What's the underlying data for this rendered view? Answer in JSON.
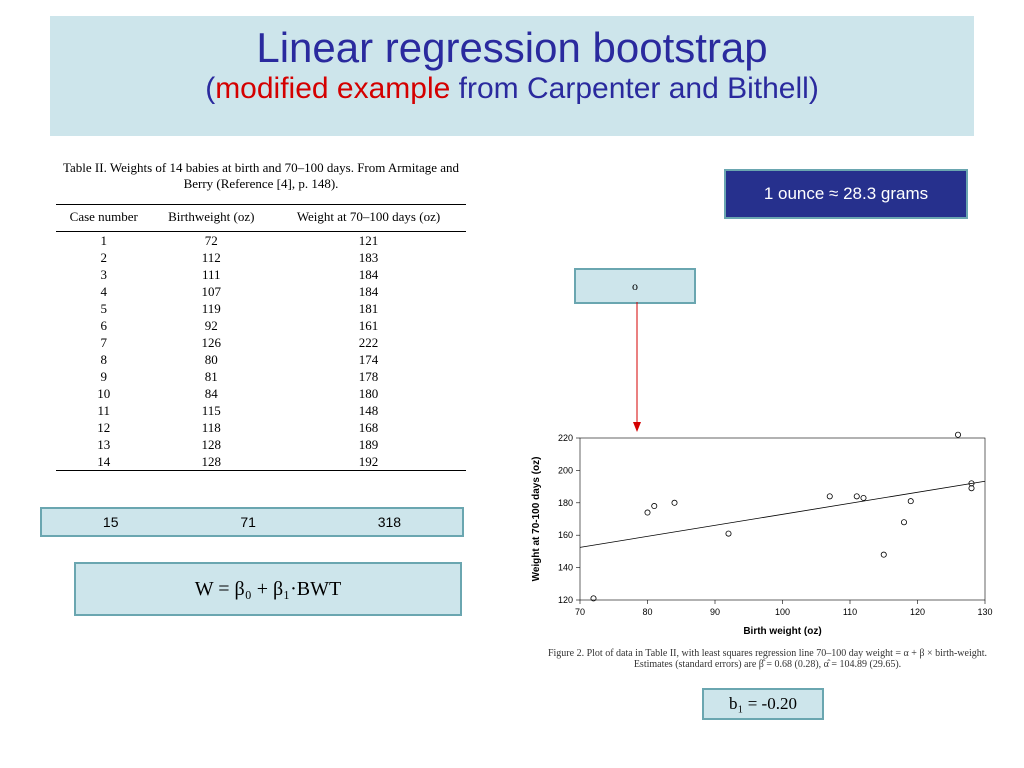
{
  "title": "Linear regression bootstrap",
  "subtitle_red": "modified example",
  "subtitle_rest": " from Carpenter and Bithell)",
  "subtitle_open": "(",
  "ounce": "1 ounce ≈ 28.3 grams",
  "outlier_mark": "o",
  "table_caption": "Table II.  Weights of 14 babies at birth and 70–100 days. From Armitage and Berry (Reference [4], p. 148).",
  "th1": "Case number",
  "th2": "Birthweight (oz)",
  "th3": "Weight at 70–100 days (oz)",
  "rows": [
    {
      "c": "1",
      "b": "72",
      "w": "121"
    },
    {
      "c": "2",
      "b": "112",
      "w": "183"
    },
    {
      "c": "3",
      "b": "111",
      "w": "184"
    },
    {
      "c": "4",
      "b": "107",
      "w": "184"
    },
    {
      "c": "5",
      "b": "119",
      "w": "181"
    },
    {
      "c": "6",
      "b": "92",
      "w": "161"
    },
    {
      "c": "7",
      "b": "126",
      "w": "222"
    },
    {
      "c": "8",
      "b": "80",
      "w": "174"
    },
    {
      "c": "9",
      "b": "81",
      "w": "178"
    },
    {
      "c": "10",
      "b": "84",
      "w": "180"
    },
    {
      "c": "11",
      "b": "115",
      "w": "148"
    },
    {
      "c": "12",
      "b": "118",
      "w": "168"
    },
    {
      "c": "13",
      "b": "128",
      "w": "189"
    },
    {
      "c": "14",
      "b": "128",
      "w": "192"
    }
  ],
  "extra_row": {
    "c": "15",
    "b": "71",
    "w": "318"
  },
  "formula": "W = β₀ + β₁·BWT",
  "b1": "b₁ = -0.20",
  "fig_caption": "Figure 2.  Plot of data in Table II, with least squares regression line 70–100 day weight = α + β × birth-weight. Estimates (standard errors) are β̂ = 0.68 (0.28), α̂ = 104.89 (29.65).",
  "chart_data": {
    "type": "scatter",
    "title": "",
    "xlabel": "Birth weight (oz)",
    "ylabel": "Weight at 70-100 days (oz)",
    "xlim": [
      70,
      130
    ],
    "ylim": [
      120,
      220
    ],
    "xticks": [
      70,
      80,
      90,
      100,
      110,
      120,
      130
    ],
    "yticks": [
      120,
      140,
      160,
      180,
      200,
      220
    ],
    "points": [
      {
        "x": 72,
        "y": 121
      },
      {
        "x": 112,
        "y": 183
      },
      {
        "x": 111,
        "y": 184
      },
      {
        "x": 107,
        "y": 184
      },
      {
        "x": 119,
        "y": 181
      },
      {
        "x": 92,
        "y": 161
      },
      {
        "x": 126,
        "y": 222
      },
      {
        "x": 80,
        "y": 174
      },
      {
        "x": 81,
        "y": 178
      },
      {
        "x": 84,
        "y": 180
      },
      {
        "x": 115,
        "y": 148
      },
      {
        "x": 118,
        "y": 168
      },
      {
        "x": 128,
        "y": 189
      },
      {
        "x": 128,
        "y": 192
      }
    ],
    "line": {
      "slope": 0.68,
      "intercept": 104.89
    }
  }
}
